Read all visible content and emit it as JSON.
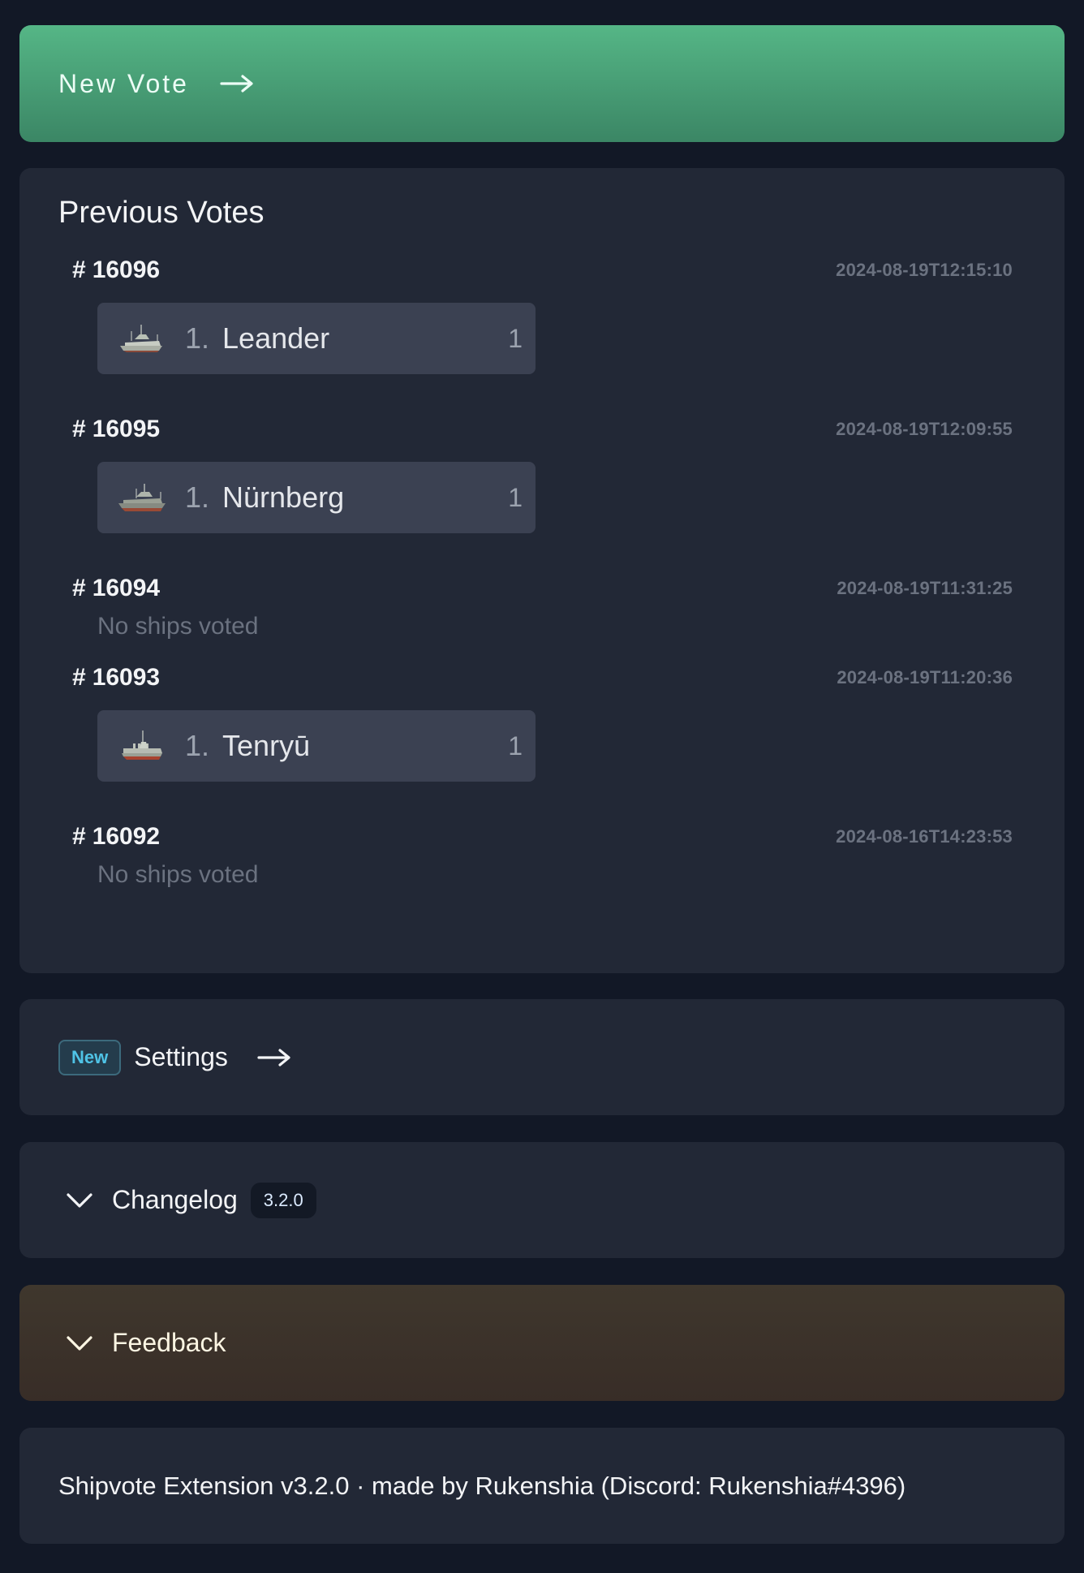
{
  "new_vote": {
    "label": "New Vote",
    "icon": "arrow-right-icon"
  },
  "previous_votes": {
    "title": "Previous Votes",
    "hash_symbol": "#",
    "empty_text": "No ships voted",
    "votes": [
      {
        "id": "16096",
        "timestamp": "2024-08-19T12:15:10",
        "ships": [
          {
            "rank": "1.",
            "name": "Leander",
            "votes": "1",
            "image": "ship-leander-icon"
          }
        ]
      },
      {
        "id": "16095",
        "timestamp": "2024-08-19T12:09:55",
        "ships": [
          {
            "rank": "1.",
            "name": "Nürnberg",
            "votes": "1",
            "image": "ship-nurnberg-icon"
          }
        ]
      },
      {
        "id": "16094",
        "timestamp": "2024-08-19T11:31:25",
        "ships": []
      },
      {
        "id": "16093",
        "timestamp": "2024-08-19T11:20:36",
        "ships": [
          {
            "rank": "1.",
            "name": "Tenryū",
            "votes": "1",
            "image": "ship-tenryu-icon"
          }
        ]
      },
      {
        "id": "16092",
        "timestamp": "2024-08-16T14:23:53",
        "ships": []
      }
    ]
  },
  "settings": {
    "badge": "New",
    "label": "Settings",
    "icon": "arrow-right-icon"
  },
  "changelog": {
    "label": "Changelog",
    "version": "3.2.0",
    "icon": "chevron-down-icon"
  },
  "feedback": {
    "label": "Feedback",
    "icon": "chevron-down-icon"
  },
  "footer": {
    "text": "Shipvote Extension v3.2.0 · made by Rukenshia (Discord: Rukenshia#4396)"
  },
  "colors": {
    "background": "#121826",
    "card": "#222836",
    "accent_green": "#55b686",
    "ship_row": "#3b4152",
    "badge_new_text": "#4fc3e6",
    "muted_text": "#6b7280",
    "feedback_bg": "#3f372d"
  }
}
